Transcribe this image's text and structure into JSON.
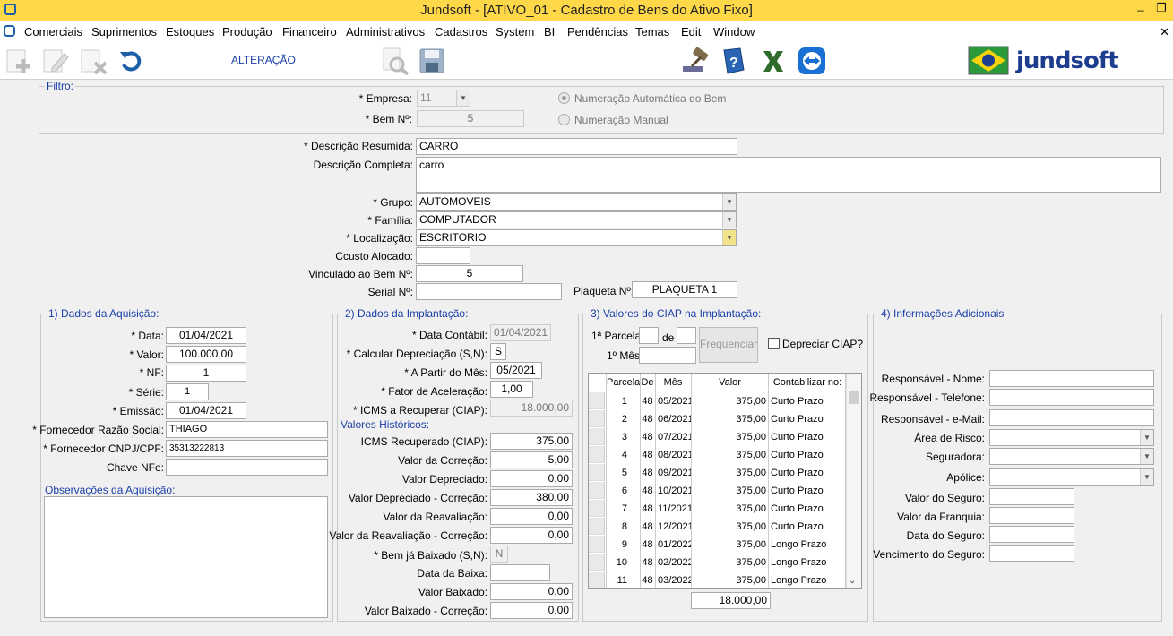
{
  "window": {
    "title": "Jundsoft - [ATIVO_01 - Cadastro de Bens do Ativo Fixo]"
  },
  "menu": [
    "Comerciais",
    "Suprimentos",
    "Estoques",
    "Produção",
    "Financeiro",
    "Administrativos",
    "Cadastros",
    "System",
    "BI",
    "Pendências",
    "Temas",
    "Edit",
    "Window"
  ],
  "toolbar": {
    "mode": "ALTERAÇÃO",
    "brand": "jundsoft"
  },
  "filter": {
    "legend": "Filtro:",
    "empresa_label": "* Empresa:",
    "empresa_value": "11",
    "bem_label": "* Bem Nº:",
    "bem_value": "5",
    "radio_auto": "Numeração Automática do Bem",
    "radio_manual": "Numeração Manual"
  },
  "main": {
    "desc_resumida_label": "* Descrição Resumida:",
    "desc_resumida": "CARRO",
    "desc_completa_label": "Descrição Completa:",
    "desc_completa": "carro",
    "grupo_label": "* Grupo:",
    "grupo": "AUTOMOVEIS",
    "familia_label": "* Família:",
    "familia": "COMPUTADOR",
    "localizacao_label": "* Localização:",
    "localizacao": "ESCRITORIO",
    "ccusto_label": "Ccusto Alocado:",
    "ccusto": "",
    "vinculado_label": "Vinculado ao Bem Nº:",
    "vinculado": "5",
    "serial_label": "Serial Nº:",
    "serial": "",
    "plaqueta_label": "Plaqueta Nº:",
    "plaqueta": "PLAQUETA 1"
  },
  "aquisicao": {
    "legend": "1) Dados da Aquisição:",
    "data_label": "* Data:",
    "data": "01/04/2021",
    "valor_label": "* Valor:",
    "valor": "100.000,00",
    "nf_label": "* NF:",
    "nf": "1",
    "serie_label": "* Série:",
    "serie": "1",
    "emissao_label": "* Emissão:",
    "emissao": "01/04/2021",
    "fornecedor_label": "* Fornecedor Razão Social:",
    "fornecedor": "THIAGO",
    "cnpj_label": "* Fornecedor CNPJ/CPF:",
    "cnpj": "35313222813",
    "chave_label": "Chave NFe:",
    "chave": "",
    "obs_label": "Observações da Aquisição:"
  },
  "implantacao": {
    "legend": "2) Dados da Implantação:",
    "data_contabil_label": "* Data Contábil:",
    "data_contabil": "01/04/2021",
    "calc_dep_label": "* Calcular Depreciação (S,N):",
    "calc_dep": "S",
    "a_partir_label": "* A Partir do Mês:",
    "a_partir": "05/2021",
    "fator_label": "* Fator de Aceleração:",
    "fator": "1,00",
    "icms_rec_label": "* ICMS a Recuperar (CIAP):",
    "icms_rec": "18.000,00",
    "hist_label": "Valores Históricos:",
    "icms_recuperado_label": "ICMS Recuperado (CIAP):",
    "icms_recuperado": "375,00",
    "valor_correcao_label": "Valor da Correção:",
    "valor_correcao": "5,00",
    "valor_depreciado_label": "Valor Depreciado:",
    "valor_depreciado": "0,00",
    "valor_dep_corr_label": "Valor Depreciado - Correção:",
    "valor_dep_corr": "380,00",
    "valor_reav_label": "Valor da Reavaliação:",
    "valor_reav": "0,00",
    "valor_reav_corr_label": "Valor da Reavaliação - Correção:",
    "valor_reav_corr": "0,00",
    "baixado_label": "* Bem já Baixado (S,N):",
    "baixado": "N",
    "data_baixa_label": "Data da Baixa:",
    "data_baixa": "",
    "valor_baixado_label": "Valor Baixado:",
    "valor_baixado": "0,00",
    "valor_baixado_corr_label": "Valor Baixado - Correção:",
    "valor_baixado_corr": "0,00"
  },
  "ciap": {
    "legend": "3) Valores do CIAP na Implantação:",
    "parcela_label": "1ª Parcela:",
    "de_label": "de",
    "mes_label": "1º Mês:",
    "frequenciar_button": "Frequenciar",
    "depreciar_label": "Depreciar CIAP?",
    "columns": [
      "Parcela",
      "De",
      "Mês",
      "Valor",
      "Contabilizar no:"
    ],
    "rows": [
      [
        "1",
        "48",
        "05/2021",
        "375,00",
        "Curto Prazo"
      ],
      [
        "2",
        "48",
        "06/2021",
        "375,00",
        "Curto Prazo"
      ],
      [
        "3",
        "48",
        "07/2021",
        "375,00",
        "Curto Prazo"
      ],
      [
        "4",
        "48",
        "08/2021",
        "375,00",
        "Curto Prazo"
      ],
      [
        "5",
        "48",
        "09/2021",
        "375,00",
        "Curto Prazo"
      ],
      [
        "6",
        "48",
        "10/2021",
        "375,00",
        "Curto Prazo"
      ],
      [
        "7",
        "48",
        "11/2021",
        "375,00",
        "Curto Prazo"
      ],
      [
        "8",
        "48",
        "12/2021",
        "375,00",
        "Curto Prazo"
      ],
      [
        "9",
        "48",
        "01/2022",
        "375,00",
        "Longo Prazo"
      ],
      [
        "10",
        "48",
        "02/2022",
        "375,00",
        "Longo Prazo"
      ],
      [
        "11",
        "48",
        "03/2022",
        "375,00",
        "Longo Prazo"
      ]
    ],
    "total": "18.000,00"
  },
  "adicionais": {
    "legend": "4) Informações Adicionais",
    "resp_nome_label": "Responsável - Nome:",
    "resp_tel_label": "Responsável - Telefone:",
    "resp_email_label": "Responsável - e-Mail:",
    "area_risco_label": "Área de Risco:",
    "seguradora_label": "Seguradora:",
    "apolice_label": "Apólice:",
    "valor_seguro_label": "Valor do Seguro:",
    "valor_franquia_label": "Valor da Franquia:",
    "data_seguro_label": "Data do Seguro:",
    "venc_seguro_label": "Vencimento do Seguro:"
  },
  "colors": {
    "titlebar": "#ffd84a",
    "legend": "#1a3fa6"
  }
}
